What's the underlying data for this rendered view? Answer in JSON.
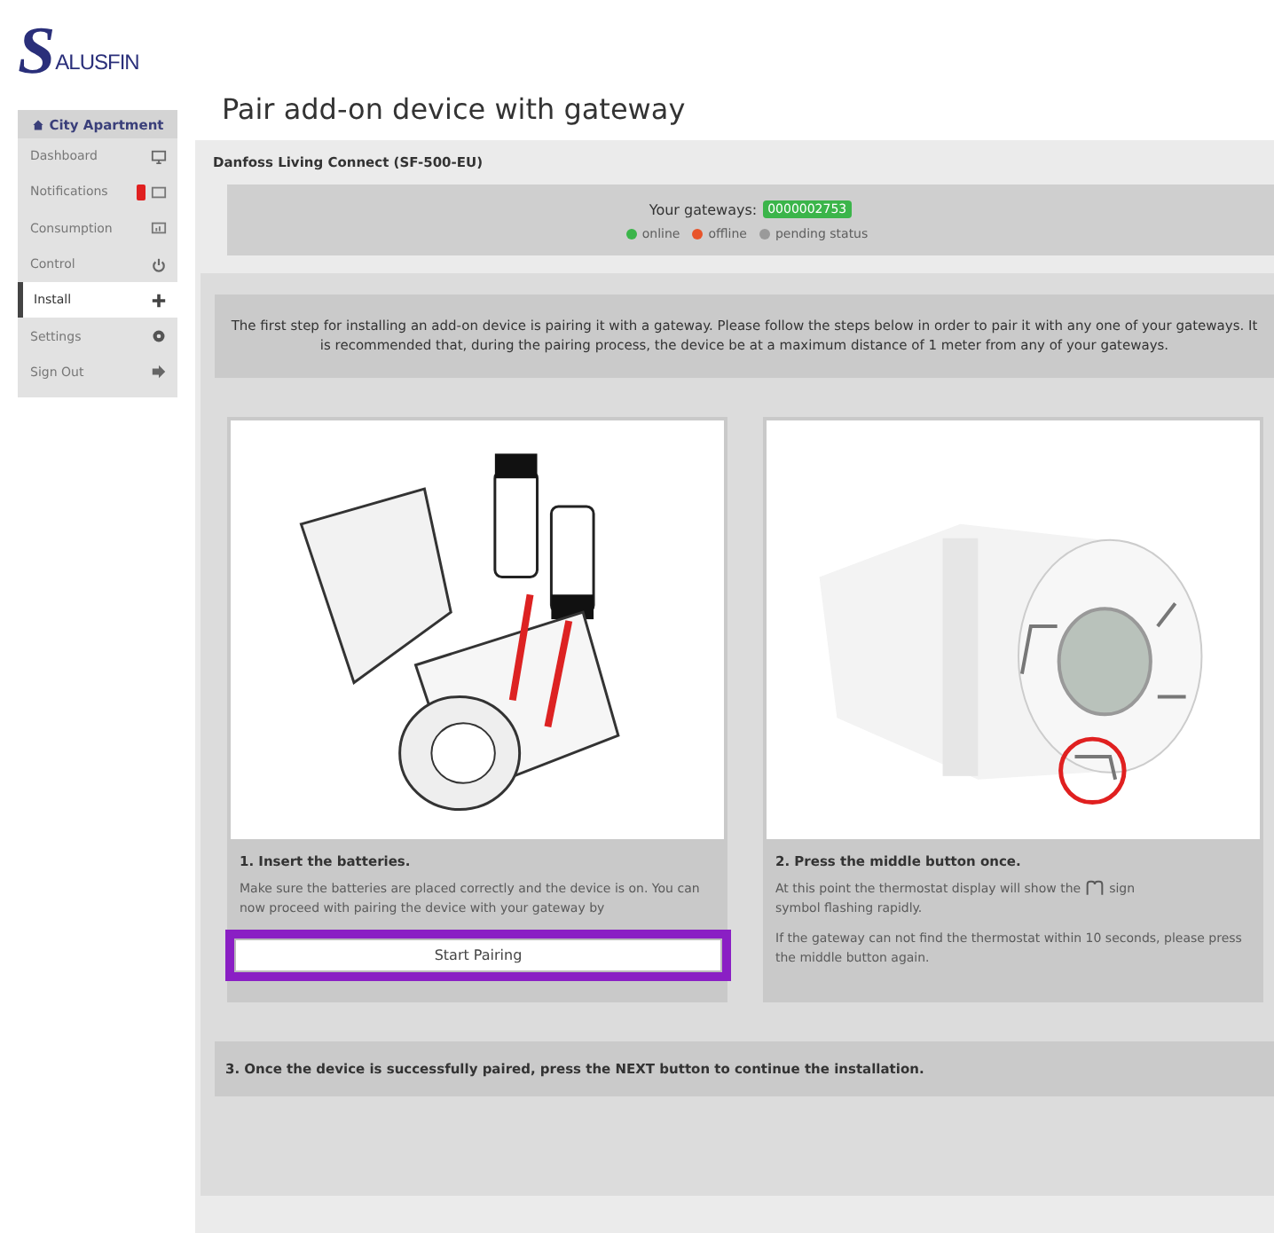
{
  "logo": {
    "letter": "S",
    "rest": "ALUSFIN"
  },
  "sidebar": {
    "header": "City Apartment",
    "items": [
      {
        "label": "Dashboard",
        "selected": false,
        "badge": false
      },
      {
        "label": "Notifications",
        "selected": false,
        "badge": true
      },
      {
        "label": "Consumption",
        "selected": false,
        "badge": false
      },
      {
        "label": "Control",
        "selected": false,
        "badge": false
      },
      {
        "label": "Install",
        "selected": true,
        "badge": false
      },
      {
        "label": "Settings",
        "selected": false,
        "badge": false
      },
      {
        "label": "Sign Out",
        "selected": false,
        "badge": false
      }
    ]
  },
  "page_title": "Pair add-on device with gateway",
  "device": "Danfoss Living Connect (SF-500-EU)",
  "gateways": {
    "label": "Your gateways:",
    "ids": [
      "0000002753"
    ],
    "legend": [
      {
        "label": "online",
        "color": "#3bb54a"
      },
      {
        "label": "offline",
        "color": "#e8542a"
      },
      {
        "label": "pending status",
        "color": "#9a9a9a"
      }
    ]
  },
  "intro": "The first step for installing an add-on device is pairing it with a gateway. Please follow the steps below in order to pair it with any one of your gateways. It is recommended that, during the pairing process, the device be at a maximum distance of 1 meter from any of your gateways.",
  "steps": [
    {
      "kind": "button",
      "title": "1. Insert the batteries.",
      "text": "Make sure the batteries are placed correctly and the device is on. You can now proceed with pairing the device with your gateway by",
      "button": "Start Pairing",
      "highlighted": true
    },
    {
      "kind": "notes",
      "title": "2. Press the middle button once.",
      "text_before": "At this point the thermostat display will show the",
      "text_after": "sign",
      "text_line2": "symbol flashing rapidly.",
      "note": "If the gateway can not find the thermostat within 10 seconds, please press the middle button again."
    }
  ],
  "final_step": "3. Once the device is successfully paired, press the NEXT button to continue the installation."
}
